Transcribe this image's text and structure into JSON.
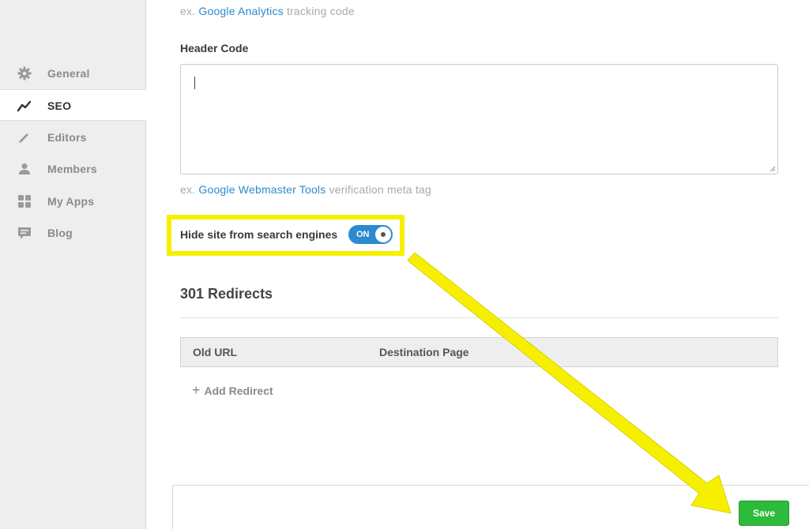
{
  "sidebar": {
    "items": [
      {
        "label": "General",
        "icon": "gear-icon"
      },
      {
        "label": "SEO",
        "icon": "trend-icon"
      },
      {
        "label": "Editors",
        "icon": "pencil-icon"
      },
      {
        "label": "Members",
        "icon": "person-icon"
      },
      {
        "label": "My Apps",
        "icon": "apps-grid-icon"
      },
      {
        "label": "Blog",
        "icon": "comment-icon"
      }
    ],
    "active": "SEO"
  },
  "main": {
    "analytics_hint": {
      "prefix": "ex.",
      "link": "Google Analytics",
      "suffix": "tracking code"
    },
    "header_code": {
      "label": "Header Code",
      "value": ""
    },
    "webmaster_hint": {
      "prefix": "ex.",
      "link": "Google Webmaster Tools",
      "suffix": "verification meta tag"
    },
    "hide_site": {
      "label": "Hide site from search engines",
      "toggle_text": "ON",
      "enabled": true
    },
    "redirects": {
      "title": "301 Redirects",
      "columns": [
        "Old URL",
        "Destination Page"
      ],
      "add_label": "Add Redirect"
    }
  },
  "footer": {
    "save_label": "Save"
  },
  "colors": {
    "accent": "#2a8bd0",
    "save": "#2dbb3b",
    "highlight": "#f6f000"
  }
}
